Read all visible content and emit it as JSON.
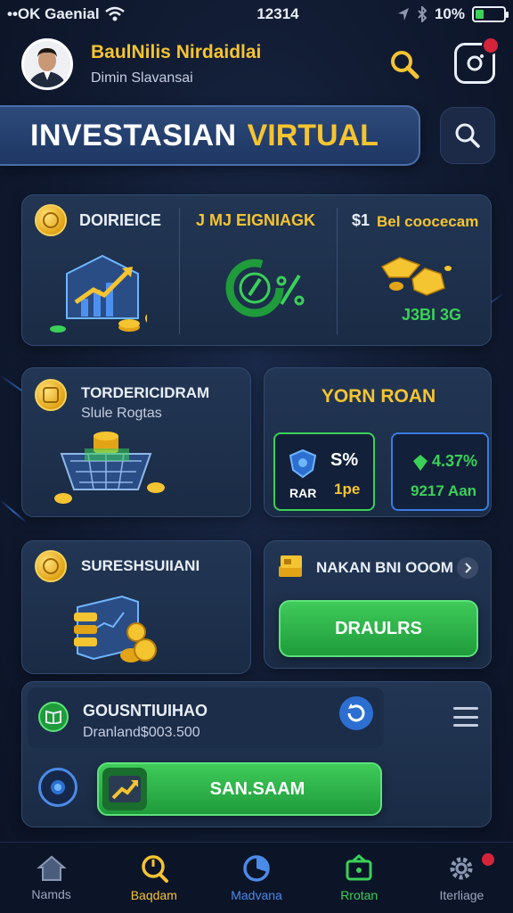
{
  "status": {
    "carrier": "••OK Gaenial",
    "time": "12314",
    "battery_pct": "10%",
    "battery_level": 0.3
  },
  "header": {
    "user_name": "BaulNilis Nirdaidlai",
    "user_sub": "Dimin Slavansai"
  },
  "title": {
    "part1": "INVESTASIAN",
    "part2": "VIRTUAL"
  },
  "stats": {
    "col1_label": "DOIRIEICE",
    "col2_label": "J MJ EIGNIAGK",
    "col3_prefix": "$1",
    "col3_label": "Bel coocecam",
    "col3_value": "J3BI 3G"
  },
  "card_trade": {
    "title": "TORDERICIDRAM",
    "sub": "Slule Rogtas"
  },
  "card_return": {
    "title": "YORN ROAN",
    "box1_pct": "S%",
    "box1_code": "RAR",
    "box1_sub": "1pe",
    "box2_pct": "4.37%",
    "box2_value": "9217 Aan"
  },
  "card_sub": {
    "title": "SURESHSUIIANI"
  },
  "card_make": {
    "title": "NAKAN BNI OOOM",
    "button": "DRAULRS"
  },
  "card_bottom": {
    "title": "GOUSNTIUIHAO",
    "sub": "Dranland$003.500",
    "button": "SAN.SAAM"
  },
  "nav": [
    {
      "label": "Namds",
      "color": "#9aa6bf",
      "icon": "home-icon"
    },
    {
      "label": "Baqdam",
      "color": "#f5c431",
      "icon": "search-icon"
    },
    {
      "label": "Madvana",
      "color": "#4b8be8",
      "icon": "pie-icon"
    },
    {
      "label": "Rrotan",
      "color": "#3ad158",
      "icon": "wallet-icon"
    },
    {
      "label": "Iterliage",
      "color": "#9aa6bf",
      "icon": "gear-icon"
    }
  ]
}
